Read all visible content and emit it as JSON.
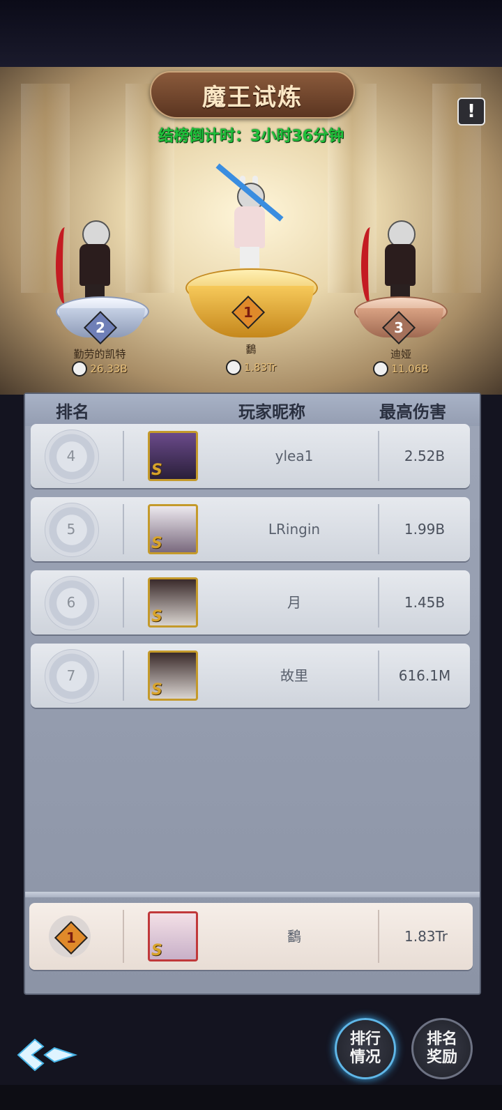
{
  "header": {
    "title": "魔王试炼",
    "countdown": "结榜倒计时：3小时36分钟"
  },
  "podium": [
    {
      "rank": "2",
      "name": "勤劳的凯特",
      "score": "26.33B"
    },
    {
      "rank": "1",
      "name": "鷭",
      "score": "1.83Tr"
    },
    {
      "rank": "3",
      "name": "迪娅",
      "score": "11.06B"
    }
  ],
  "board": {
    "columns": {
      "rank": "排名",
      "player": "玩家昵称",
      "damage": "最高伤害"
    },
    "rows": [
      {
        "rank": "4",
        "name": "ylea1",
        "damage": "2.52B"
      },
      {
        "rank": "5",
        "name": "LRingin",
        "damage": "1.99B"
      },
      {
        "rank": "6",
        "name": "月",
        "damage": "1.45B"
      },
      {
        "rank": "7",
        "name": "故里",
        "damage": "616.1M"
      }
    ],
    "me": {
      "rank": "1",
      "name": "鷭",
      "damage": "1.83Tr"
    }
  },
  "buttons": {
    "ranking_status_line1": "排行",
    "ranking_status_line2": "情况",
    "rank_rewards_line1": "排名",
    "rank_rewards_line2": "奖励"
  },
  "icons": {
    "info": "!",
    "avatar_grade": "S"
  },
  "colors": {
    "countdown": "#1fbf3a",
    "gold": "#c49a2b",
    "active_glow": "#3aa2e0"
  }
}
